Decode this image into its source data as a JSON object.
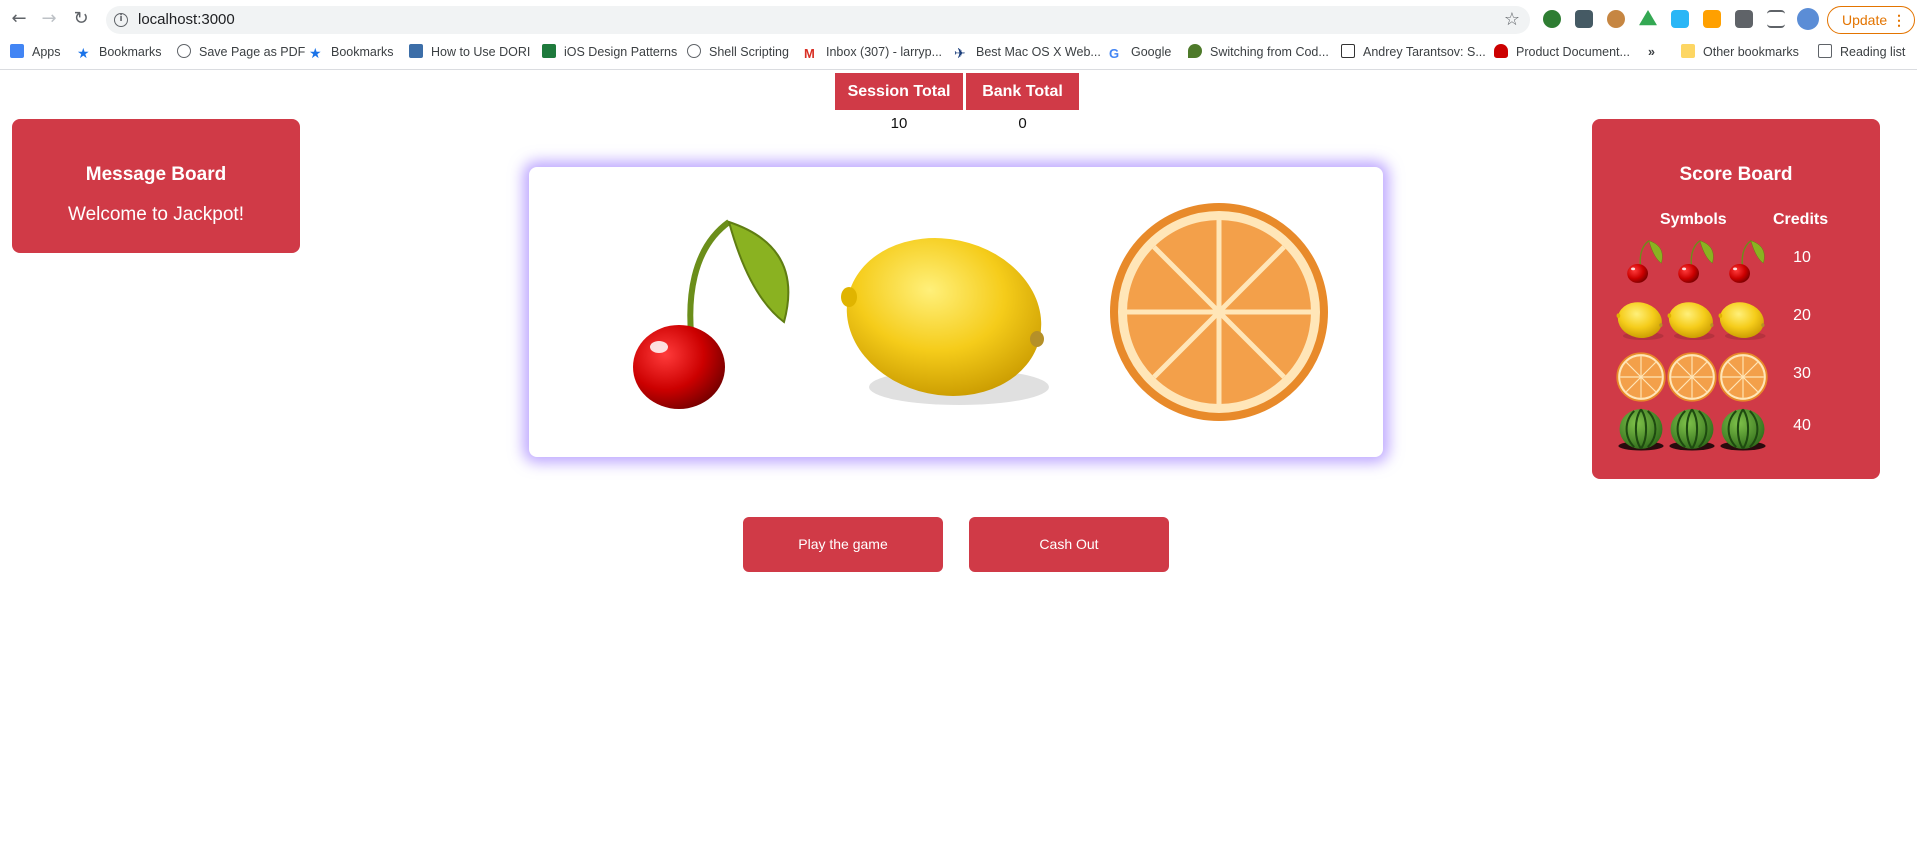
{
  "browser": {
    "url": "localhost:3000",
    "update_label": "Update",
    "bookmarks": [
      {
        "label": "Apps",
        "icon": "apps-grid-icon",
        "color": "#4285f4"
      },
      {
        "label": "Bookmarks",
        "icon": "star-icon",
        "color": "#1a73e8"
      },
      {
        "label": "Save Page as PDF",
        "icon": "globe-icon",
        "color": "#5f6368"
      },
      {
        "label": "Bookmarks",
        "icon": "star-icon",
        "color": "#1a73e8"
      },
      {
        "label": "How to Use DORI",
        "icon": "dori-icon",
        "color": "#3c6ea8"
      },
      {
        "label": "iOS Design Patterns",
        "icon": "ios-patterns-icon",
        "color": "#1e7a3c"
      },
      {
        "label": "Shell Scripting",
        "icon": "globe-icon",
        "color": "#5f6368"
      },
      {
        "label": "Inbox (307) - larryp...",
        "icon": "gmail-icon",
        "color": "#d93025"
      },
      {
        "label": "Best Mac OS X Web...",
        "icon": "plane-icon",
        "color": "#1a3d7a"
      },
      {
        "label": "Google",
        "icon": "google-icon",
        "color": "#4285f4"
      },
      {
        "label": "Switching from Cod...",
        "icon": "leaf-icon",
        "color": "#4e7a2a"
      },
      {
        "label": "Andrey Tarantsov: S...",
        "icon": "square-icon",
        "color": "#333333"
      },
      {
        "label": "Product Document...",
        "icon": "redhat-icon",
        "color": "#cc0000"
      }
    ],
    "overflow": "»",
    "other_bookmarks": "Other bookmarks",
    "reading_list": "Reading list"
  },
  "totals": {
    "session_label": "Session Total",
    "session_value": "10",
    "bank_label": "Bank Total",
    "bank_value": "0"
  },
  "message_board": {
    "title": "Message Board",
    "message": "Welcome to Jackpot!"
  },
  "reels": [
    "cherry",
    "lemon",
    "orange"
  ],
  "score_board": {
    "title": "Score Board",
    "symbols_header": "Symbols",
    "credits_header": "Credits",
    "rows": [
      {
        "symbol": "cherry",
        "credits": "10"
      },
      {
        "symbol": "lemon",
        "credits": "20"
      },
      {
        "symbol": "orange",
        "credits": "30"
      },
      {
        "symbol": "watermelon",
        "credits": "40"
      }
    ]
  },
  "actions": {
    "play_label": "Play the game",
    "cashout_label": "Cash Out"
  },
  "colors": {
    "accent": "#d03a47",
    "reel_glow": "#aa8cff"
  }
}
